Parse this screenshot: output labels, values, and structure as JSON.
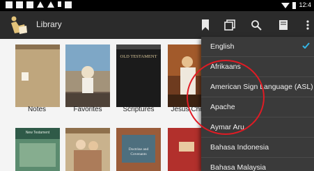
{
  "status_bar": {
    "time": "12:4"
  },
  "app_bar": {
    "title": "Library"
  },
  "library": {
    "items": [
      {
        "label": "Notes"
      },
      {
        "label": "Favorites"
      },
      {
        "label": "Scriptures",
        "cover_text": "OLD TESTAMENT"
      },
      {
        "label": "Jesus Christ"
      }
    ],
    "bottom_row": [
      {
        "cover_text": "New Testament"
      },
      {
        "cover_text": ""
      },
      {
        "cover_text": "Doctrine and Covenants"
      },
      {
        "cover_text": ""
      }
    ]
  },
  "menu": {
    "items": [
      {
        "label": "English",
        "selected": true
      },
      {
        "label": "Afrikaans"
      },
      {
        "label": "American Sign Language (ASL)"
      },
      {
        "label": "Apache"
      },
      {
        "label": "Aymar Aru"
      },
      {
        "label": "Bahasa Indonesia"
      },
      {
        "label": "Bahasa Malaysia"
      }
    ]
  },
  "colors": {
    "app_bar": "#2b2b2b",
    "menu_bg": "#3a3a3a",
    "accent": "#33b5e5",
    "annotation": "#e01b24"
  }
}
